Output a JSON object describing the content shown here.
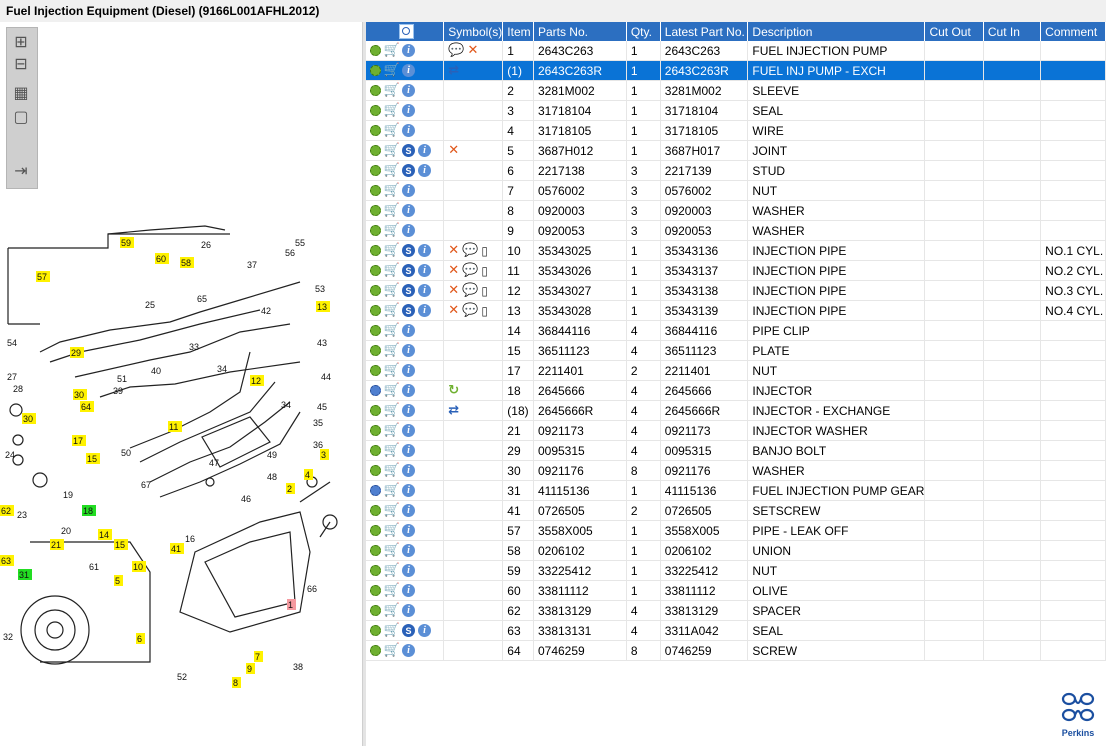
{
  "window": {
    "title": "Fuel Injection Equipment (Diesel) (9166L001AFHL2012)"
  },
  "toolbar": [
    {
      "name": "zoom-in-icon",
      "glyph": "⊞"
    },
    {
      "name": "zoom-out-icon",
      "glyph": "⊟"
    },
    {
      "name": "fit-all-icon",
      "glyph": "▦"
    },
    {
      "name": "fit-window-icon",
      "glyph": "▢"
    },
    {
      "name": "export-icon",
      "glyph": "⇥"
    }
  ],
  "table": {
    "columns": [
      "",
      "Symbol(s)",
      "Item",
      "Parts No.",
      "Qty.",
      "Latest Part No.",
      "Description",
      "Cut Out",
      "Cut In",
      "Comment"
    ],
    "rows": [
      {
        "item": "1",
        "part": "2643C263",
        "qty": "1",
        "latest": "2643C263",
        "desc": "FUEL INJECTION PUMP",
        "comment": "",
        "s": false,
        "gear": "green",
        "syms": [
          "note",
          "x"
        ]
      },
      {
        "item": "(1)",
        "part": "2643C263R",
        "qty": "1",
        "latest": "2643C263R",
        "desc": "FUEL INJ PUMP - EXCH",
        "comment": "",
        "s": false,
        "gear": "green",
        "syms": [
          "swap"
        ],
        "selected": true
      },
      {
        "item": "2",
        "part": "3281M002",
        "qty": "1",
        "latest": "3281M002",
        "desc": "SLEEVE",
        "comment": "",
        "s": false,
        "gear": "green",
        "syms": []
      },
      {
        "item": "3",
        "part": "31718104",
        "qty": "1",
        "latest": "31718104",
        "desc": "SEAL",
        "comment": "",
        "s": false,
        "gear": "green",
        "syms": []
      },
      {
        "item": "4",
        "part": "31718105",
        "qty": "1",
        "latest": "31718105",
        "desc": "WIRE",
        "comment": "",
        "s": false,
        "gear": "green",
        "syms": []
      },
      {
        "item": "5",
        "part": "3687H012",
        "qty": "1",
        "latest": "3687H017",
        "desc": "JOINT",
        "comment": "",
        "s": true,
        "gear": "green",
        "syms": [
          "x"
        ]
      },
      {
        "item": "6",
        "part": "2217138",
        "qty": "3",
        "latest": "2217139",
        "desc": "STUD",
        "comment": "",
        "s": true,
        "gear": "green",
        "syms": []
      },
      {
        "item": "7",
        "part": "0576002",
        "qty": "3",
        "latest": "0576002",
        "desc": "NUT",
        "comment": "",
        "s": false,
        "gear": "green",
        "syms": []
      },
      {
        "item": "8",
        "part": "0920003",
        "qty": "3",
        "latest": "0920003",
        "desc": "WASHER",
        "comment": "",
        "s": false,
        "gear": "green",
        "syms": []
      },
      {
        "item": "9",
        "part": "0920053",
        "qty": "3",
        "latest": "0920053",
        "desc": "WASHER",
        "comment": "",
        "s": false,
        "gear": "green",
        "syms": []
      },
      {
        "item": "10",
        "part": "35343025",
        "qty": "1",
        "latest": "35343136",
        "desc": "INJECTION PIPE",
        "comment": "NO.1 CYL.",
        "s": true,
        "gear": "green",
        "syms": [
          "x",
          "note",
          "can"
        ]
      },
      {
        "item": "11",
        "part": "35343026",
        "qty": "1",
        "latest": "35343137",
        "desc": "INJECTION PIPE",
        "comment": "NO.2 CYL.",
        "s": true,
        "gear": "green",
        "syms": [
          "x",
          "note",
          "can"
        ]
      },
      {
        "item": "12",
        "part": "35343027",
        "qty": "1",
        "latest": "35343138",
        "desc": "INJECTION PIPE",
        "comment": "NO.3 CYL.",
        "s": true,
        "gear": "green",
        "syms": [
          "x",
          "note",
          "can"
        ]
      },
      {
        "item": "13",
        "part": "35343028",
        "qty": "1",
        "latest": "35343139",
        "desc": "INJECTION PIPE",
        "comment": "NO.4 CYL.",
        "s": true,
        "gear": "green",
        "syms": [
          "x",
          "note",
          "can"
        ]
      },
      {
        "item": "14",
        "part": "36844116",
        "qty": "4",
        "latest": "36844116",
        "desc": "PIPE CLIP",
        "comment": "",
        "s": false,
        "gear": "green",
        "syms": []
      },
      {
        "item": "15",
        "part": "36511123",
        "qty": "4",
        "latest": "36511123",
        "desc": "PLATE",
        "comment": "",
        "s": false,
        "gear": "green",
        "syms": []
      },
      {
        "item": "17",
        "part": "2211401",
        "qty": "2",
        "latest": "2211401",
        "desc": "NUT",
        "comment": "",
        "s": false,
        "gear": "green",
        "syms": []
      },
      {
        "item": "18",
        "part": "2645666",
        "qty": "4",
        "latest": "2645666",
        "desc": "INJECTOR",
        "comment": "",
        "s": false,
        "gear": "blue",
        "syms": [
          "cyc"
        ]
      },
      {
        "item": "(18)",
        "part": "2645666R",
        "qty": "4",
        "latest": "2645666R",
        "desc": "INJECTOR - EXCHANGE",
        "comment": "",
        "s": false,
        "gear": "green",
        "syms": [
          "swap"
        ]
      },
      {
        "item": "21",
        "part": "0921173",
        "qty": "4",
        "latest": "0921173",
        "desc": "INJECTOR WASHER",
        "comment": "",
        "s": false,
        "gear": "green",
        "syms": []
      },
      {
        "item": "29",
        "part": "0095315",
        "qty": "4",
        "latest": "0095315",
        "desc": "BANJO BOLT",
        "comment": "",
        "s": false,
        "gear": "green",
        "syms": []
      },
      {
        "item": "30",
        "part": "0921176",
        "qty": "8",
        "latest": "0921176",
        "desc": "WASHER",
        "comment": "",
        "s": false,
        "gear": "green",
        "syms": []
      },
      {
        "item": "31",
        "part": "41115136",
        "qty": "1",
        "latest": "41115136",
        "desc": "FUEL INJECTION PUMP GEAR",
        "comment": "",
        "s": false,
        "gear": "blue",
        "syms": []
      },
      {
        "item": "41",
        "part": "0726505",
        "qty": "2",
        "latest": "0726505",
        "desc": "SETSCREW",
        "comment": "",
        "s": false,
        "gear": "green",
        "syms": []
      },
      {
        "item": "57",
        "part": "3558X005",
        "qty": "1",
        "latest": "3558X005",
        "desc": "PIPE - LEAK OFF",
        "comment": "",
        "s": false,
        "gear": "green",
        "syms": []
      },
      {
        "item": "58",
        "part": "0206102",
        "qty": "1",
        "latest": "0206102",
        "desc": "UNION",
        "comment": "",
        "s": false,
        "gear": "green",
        "syms": []
      },
      {
        "item": "59",
        "part": "33225412",
        "qty": "1",
        "latest": "33225412",
        "desc": "NUT",
        "comment": "",
        "s": false,
        "gear": "green",
        "syms": []
      },
      {
        "item": "60",
        "part": "33811112",
        "qty": "1",
        "latest": "33811112",
        "desc": "OLIVE",
        "comment": "",
        "s": false,
        "gear": "green",
        "syms": []
      },
      {
        "item": "62",
        "part": "33813129",
        "qty": "4",
        "latest": "33813129",
        "desc": "SPACER",
        "comment": "",
        "s": false,
        "gear": "green",
        "syms": []
      },
      {
        "item": "63",
        "part": "33813131",
        "qty": "4",
        "latest": "3311A042",
        "desc": "SEAL",
        "comment": "",
        "s": true,
        "gear": "green",
        "syms": []
      },
      {
        "item": "64",
        "part": "0746259",
        "qty": "8",
        "latest": "0746259",
        "desc": "SCREW",
        "comment": "",
        "s": false,
        "gear": "green",
        "syms": []
      }
    ]
  },
  "diagram": {
    "callouts": [
      {
        "n": "59",
        "c": "y"
      },
      {
        "n": "60",
        "c": "y"
      },
      {
        "n": "58",
        "c": "y"
      },
      {
        "n": "26",
        "c": "n"
      },
      {
        "n": "55",
        "c": "n"
      },
      {
        "n": "56",
        "c": "n"
      },
      {
        "n": "37",
        "c": "n"
      },
      {
        "n": "57",
        "c": "y"
      },
      {
        "n": "65",
        "c": "n"
      },
      {
        "n": "53",
        "c": "n"
      },
      {
        "n": "25",
        "c": "n"
      },
      {
        "n": "42",
        "c": "n"
      },
      {
        "n": "13",
        "c": "y"
      },
      {
        "n": "43",
        "c": "n"
      },
      {
        "n": "44",
        "c": "n"
      },
      {
        "n": "54",
        "c": "n"
      },
      {
        "n": "29",
        "c": "y"
      },
      {
        "n": "33",
        "c": "n"
      },
      {
        "n": "27",
        "c": "n"
      },
      {
        "n": "51",
        "c": "n"
      },
      {
        "n": "40",
        "c": "n"
      },
      {
        "n": "34",
        "c": "n"
      },
      {
        "n": "12",
        "c": "y"
      },
      {
        "n": "28",
        "c": "n"
      },
      {
        "n": "30",
        "c": "y"
      },
      {
        "n": "39",
        "c": "n"
      },
      {
        "n": "64",
        "c": "y"
      },
      {
        "n": "34",
        "c": "n"
      },
      {
        "n": "45",
        "c": "n"
      },
      {
        "n": "30",
        "c": "y"
      },
      {
        "n": "35",
        "c": "n"
      },
      {
        "n": "36",
        "c": "n"
      },
      {
        "n": "11",
        "c": "y"
      },
      {
        "n": "24",
        "c": "n"
      },
      {
        "n": "17",
        "c": "y"
      },
      {
        "n": "15",
        "c": "y"
      },
      {
        "n": "50",
        "c": "n"
      },
      {
        "n": "47",
        "c": "n"
      },
      {
        "n": "49",
        "c": "n"
      },
      {
        "n": "48",
        "c": "n"
      },
      {
        "n": "3",
        "c": "y"
      },
      {
        "n": "67",
        "c": "n"
      },
      {
        "n": "19",
        "c": "n"
      },
      {
        "n": "46",
        "c": "n"
      },
      {
        "n": "2",
        "c": "y"
      },
      {
        "n": "4",
        "c": "y"
      },
      {
        "n": "62",
        "c": "y"
      },
      {
        "n": "23",
        "c": "n"
      },
      {
        "n": "18",
        "c": "g"
      },
      {
        "n": "14",
        "c": "y"
      },
      {
        "n": "20",
        "c": "n"
      },
      {
        "n": "21",
        "c": "y"
      },
      {
        "n": "15",
        "c": "y"
      },
      {
        "n": "16",
        "c": "n"
      },
      {
        "n": "41",
        "c": "y"
      },
      {
        "n": "63",
        "c": "y"
      },
      {
        "n": "61",
        "c": "n"
      },
      {
        "n": "10",
        "c": "y"
      },
      {
        "n": "66",
        "c": "n"
      },
      {
        "n": "31",
        "c": "g"
      },
      {
        "n": "5",
        "c": "y"
      },
      {
        "n": "1",
        "c": "r"
      },
      {
        "n": "32",
        "c": "n"
      },
      {
        "n": "6",
        "c": "y"
      },
      {
        "n": "7",
        "c": "y"
      },
      {
        "n": "38",
        "c": "n"
      },
      {
        "n": "9",
        "c": "y"
      },
      {
        "n": "52",
        "c": "n"
      },
      {
        "n": "8",
        "c": "y"
      }
    ]
  },
  "brand": {
    "logo_text": "Perkins"
  }
}
